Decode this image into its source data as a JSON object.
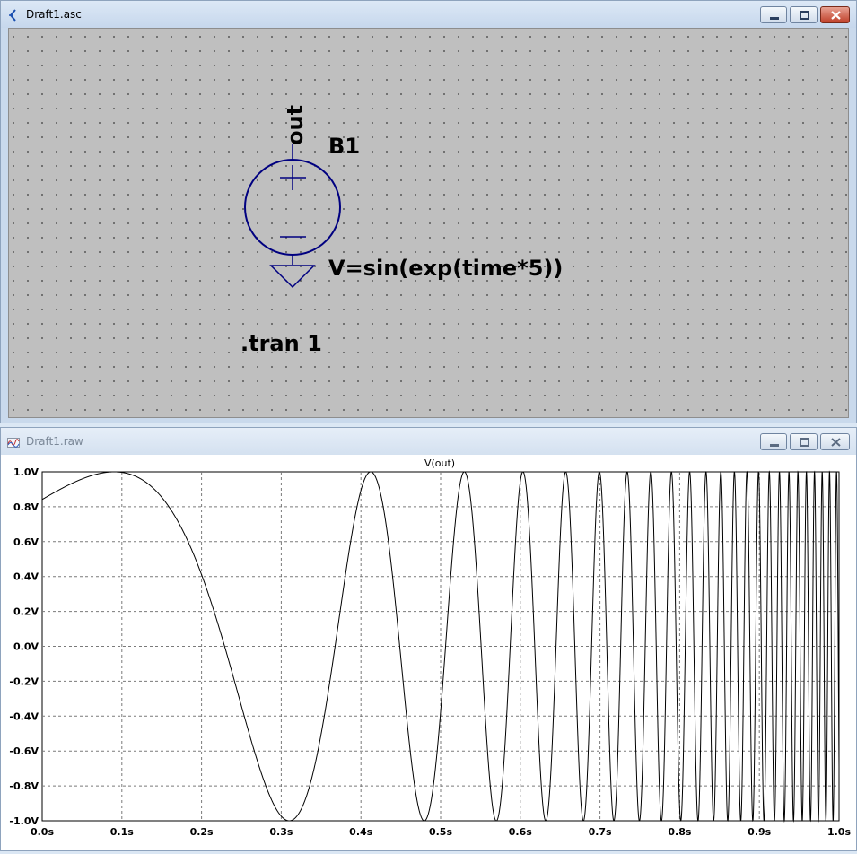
{
  "schematic_window": {
    "title": "Draft1.asc",
    "component": {
      "net_label": "out",
      "name": "B1",
      "value": "V=sin(exp(time*5))"
    },
    "directive": ".tran 1"
  },
  "waveform_window": {
    "title": "Draft1.raw",
    "chart_data": {
      "type": "line",
      "title": "V(out)",
      "xlabel": "",
      "ylabel": "",
      "xlim": [
        0,
        1
      ],
      "ylim": [
        -1,
        1
      ],
      "grid": true,
      "x_ticks": [
        "0.0s",
        "0.1s",
        "0.2s",
        "0.3s",
        "0.4s",
        "0.5s",
        "0.6s",
        "0.7s",
        "0.8s",
        "0.9s",
        "1.0s"
      ],
      "y_ticks": [
        "1.0V",
        "0.8V",
        "0.6V",
        "0.4V",
        "0.2V",
        "0.0V",
        "-0.2V",
        "-0.4V",
        "-0.6V",
        "-0.8V",
        "-1.0V"
      ],
      "series": [
        {
          "name": "V(out)",
          "expression": "sin(exp(time*5))",
          "x_range": [
            0,
            1
          ],
          "color": "#000000"
        }
      ]
    }
  },
  "colors": {
    "component": "#000080",
    "schematic_bg": "#bfbfbf",
    "trace": "#000000"
  }
}
